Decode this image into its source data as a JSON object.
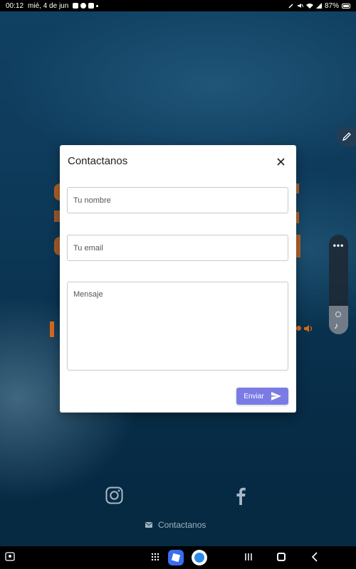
{
  "status_bar": {
    "time": "00:12",
    "date": "mié, 4 de jun",
    "battery": "87%"
  },
  "modal": {
    "title": "Contactanos",
    "name_placeholder": "Tu nombre",
    "email_placeholder": "Tu email",
    "message_placeholder": "Mensaje",
    "send_label": "Enviar"
  },
  "footer": {
    "contact_label": "Contactanos"
  },
  "colors": {
    "accent": "#7b7be6",
    "background": "#0c2f47"
  },
  "icons": [
    "close-icon",
    "send-icon",
    "instagram-icon",
    "facebook-icon",
    "mail-icon",
    "edit-icon"
  ]
}
